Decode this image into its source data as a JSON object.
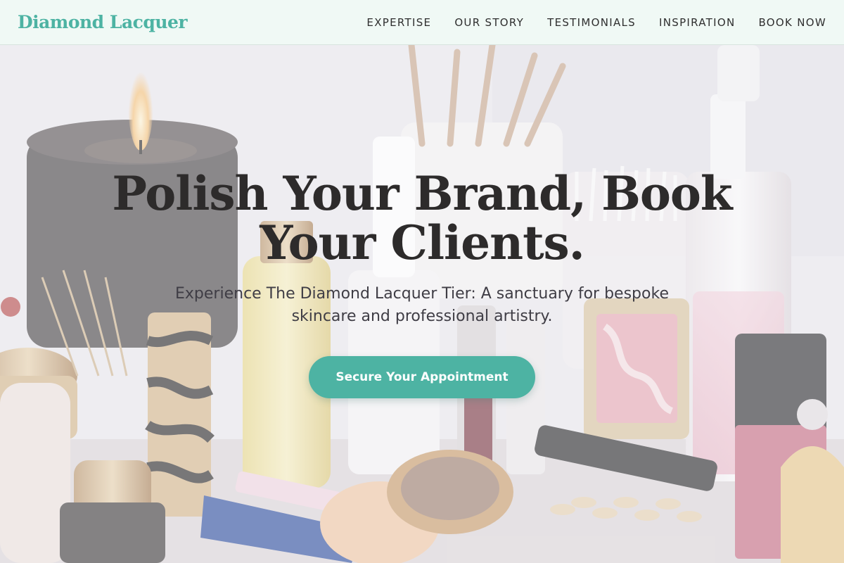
{
  "header": {
    "brand": "Diamond Lacquer",
    "nav": [
      {
        "label": "EXPERTISE"
      },
      {
        "label": "OUR STORY"
      },
      {
        "label": "TESTIMONIALS"
      },
      {
        "label": "INSPIRATION"
      },
      {
        "label": "BOOK NOW"
      }
    ]
  },
  "hero": {
    "headline_line1": "Polish Your Brand, Book",
    "headline_line2": "Your Clients.",
    "subheadline": "Experience The Diamond Lacquer Tier: A sanctuary for bespoke skincare and professional artistry.",
    "cta_label": "Secure Your Appointment"
  },
  "colors": {
    "accent": "#4db3a3",
    "header_bg": "#f0f9f5",
    "headline": "#2d2b2b",
    "subheadline": "#3f3d45"
  }
}
